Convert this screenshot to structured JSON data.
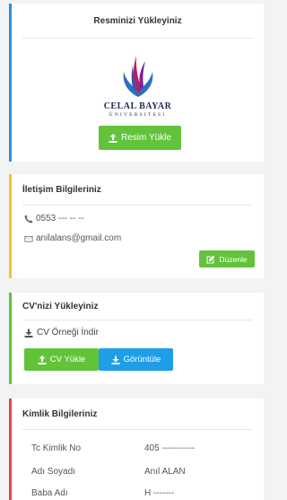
{
  "photo": {
    "title": "Resminizi Yükleyiniz",
    "logo_name": "CELAL BAYAR",
    "logo_sub": "ÜNIVERSITESI",
    "upload_label": "Resim Yükle"
  },
  "contact": {
    "title": "İletişim Bilgileriniz",
    "phone": "0553 --- -- --",
    "email": "anilalans@gmail.com",
    "edit_label": "Düzenle"
  },
  "cv": {
    "title": "CV'nizi Yükleyiniz",
    "sample_link": "CV Örneği İndir",
    "upload_label": "CV Yükle",
    "view_label": "Görüntüle"
  },
  "identity": {
    "title": "Kimlik Bilgileriniz",
    "rows": [
      {
        "key": "Tc Kimlik No",
        "value": "405 -----------"
      },
      {
        "key": "Adı Soyadı",
        "value": "Anıl ALAN"
      },
      {
        "key": "Baba Adı",
        "value": "H -------"
      }
    ]
  },
  "colors": {
    "photo_accent": "#2f8fe0",
    "contact_accent": "#f2c331",
    "cv_accent": "#62c33b",
    "identity_accent": "#e04646",
    "button_green": "#62c33b",
    "button_blue": "#1f9ee8"
  },
  "icons": {
    "upload": "upload-icon",
    "phone": "phone-icon",
    "email": "envelope-icon",
    "edit": "edit-icon",
    "download": "download-icon"
  }
}
